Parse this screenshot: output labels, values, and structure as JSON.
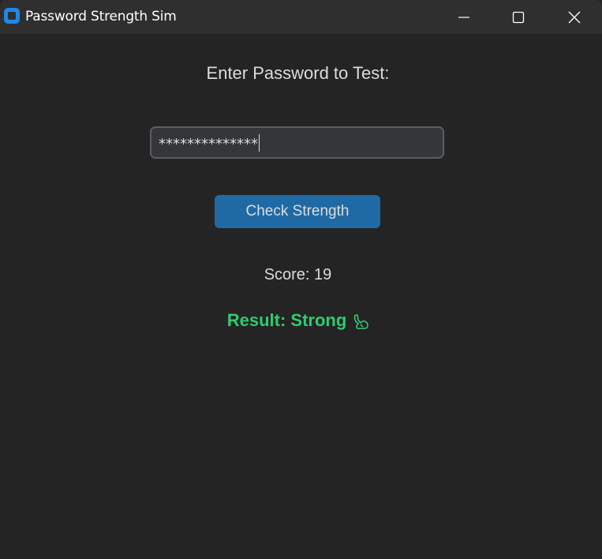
{
  "window": {
    "title": "Password Strength Sim",
    "controls": {
      "minimize": "minimize",
      "maximize": "maximize",
      "close": "close"
    }
  },
  "form": {
    "prompt": "Enter Password to Test:",
    "password_value": "**************",
    "check_button_label": "Check Strength"
  },
  "output": {
    "score_text": "Score: 19",
    "result_text": "Result: Strong",
    "result_icon": "flexed-arm-icon",
    "result_color": "#2ecc71"
  },
  "colors": {
    "background": "#242424",
    "titlebar": "#2f2f2f",
    "accent": "#1f6aa5",
    "app_icon": "#1e88e5"
  }
}
